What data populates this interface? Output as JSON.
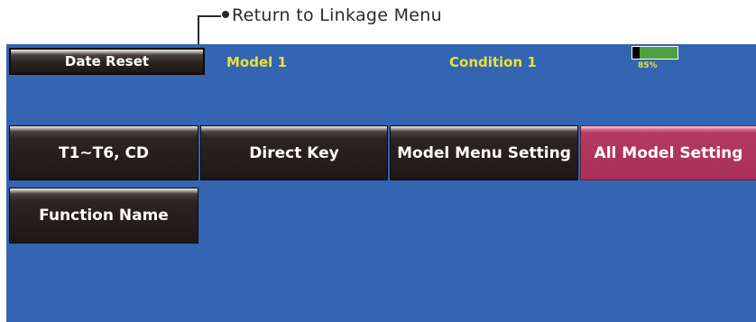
{
  "annotation": {
    "label": "Return to Linkage Menu"
  },
  "top_bar": {
    "reset_button": "Date Reset",
    "model_name": "Model 1",
    "condition": "Condition 1",
    "battery": {
      "level_fraction": 0.85,
      "label": "85%",
      "fill_color": "#4ea043"
    }
  },
  "menu": {
    "buttons": [
      {
        "label": "T1~T6, CD",
        "style": "dark"
      },
      {
        "label": "Direct Key",
        "style": "dark"
      },
      {
        "label": "Model Menu Setting",
        "style": "dark"
      },
      {
        "label": "All Model Setting",
        "style": "selected",
        "color": "#a82f58"
      },
      {
        "label": "Function Name",
        "style": "dark"
      }
    ]
  },
  "colors": {
    "screen_background": "#3465b2",
    "status_text": "#e8e23a"
  }
}
